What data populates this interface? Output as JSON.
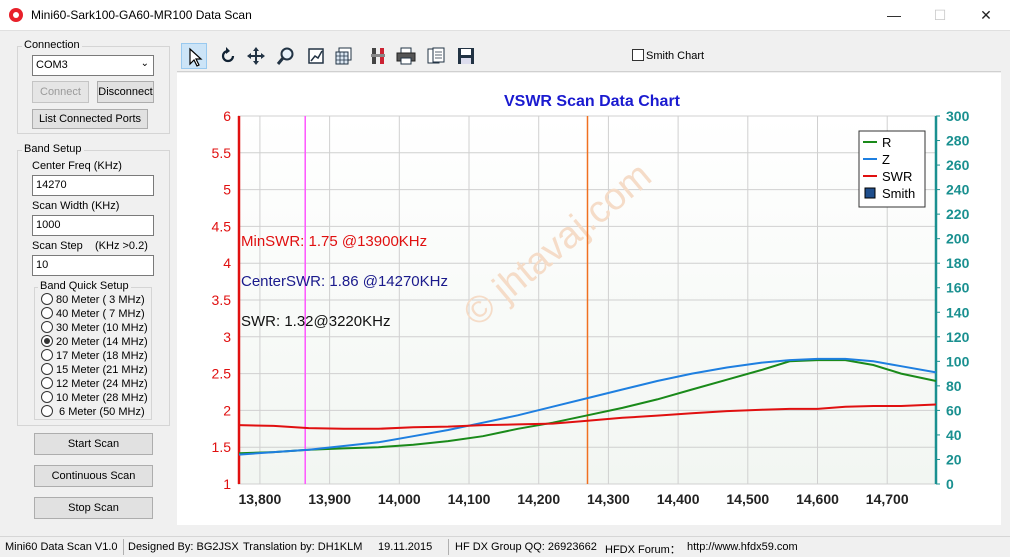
{
  "window": {
    "title": "Mini60-Sark100-GA60-MR100 Data Scan",
    "minimize": "—",
    "maximize": "☐",
    "close": "✕"
  },
  "connection": {
    "group_title": "Connection",
    "port": "COM3",
    "connect_label": "Connect",
    "disconnect_label": "Disconnect",
    "list_ports_label": "List Connected Ports"
  },
  "band_setup": {
    "group_title": "Band Setup",
    "center_freq_label": "Center Freq  (KHz)",
    "center_freq_value": "14270",
    "scan_width_label": "Scan Width   (KHz)",
    "scan_width_value": "1000",
    "scan_step_label": "Scan Step",
    "scan_step_hint": "(KHz >0.2)",
    "scan_step_value": "10",
    "quick_title": "Band Quick Setup",
    "bands": [
      {
        "label": "80 Meter (  3 MHz)",
        "checked": false
      },
      {
        "label": "40 Meter (  7 MHz)",
        "checked": false
      },
      {
        "label": "30 Meter (10 MHz)",
        "checked": false
      },
      {
        "label": "20 Meter (14 MHz)",
        "checked": true
      },
      {
        "label": "17 Meter (18 MHz)",
        "checked": false
      },
      {
        "label": "15 Meter (21 MHz)",
        "checked": false
      },
      {
        "label": "12 Meter (24 MHz)",
        "checked": false
      },
      {
        "label": "10 Meter (28 MHz)",
        "checked": false
      },
      {
        "label": "  6 Meter  (50 MHz)",
        "checked": false
      }
    ]
  },
  "actions": {
    "start": "Start Scan",
    "continuous": "Continuous Scan",
    "stop": "Stop Scan"
  },
  "toolbar": {
    "smith_chart_label": "Smith Chart",
    "smith_chart_checked": false
  },
  "watermark": "© jhtavaj.com",
  "chart_data": {
    "type": "line",
    "title": "VSWR Scan Data Chart",
    "x_ticks": [
      "13,800",
      "13,900",
      "14,000",
      "14,100",
      "14,200",
      "14,300",
      "14,400",
      "14,500",
      "14,600",
      "14,700"
    ],
    "x_tick_values": [
      13800,
      13900,
      14000,
      14100,
      14200,
      14300,
      14400,
      14500,
      14600,
      14700
    ],
    "xlim": [
      13770,
      14770
    ],
    "y_left_ticks": [
      "1",
      "1.5",
      "2",
      "2.5",
      "3",
      "3.5",
      "4",
      "4.5",
      "5",
      "5.5",
      "6"
    ],
    "y_left_lim": [
      1,
      6
    ],
    "y_right_ticks": [
      "0",
      "20",
      "40",
      "60",
      "80",
      "100",
      "120",
      "140",
      "160",
      "180",
      "200",
      "220",
      "240",
      "260",
      "280",
      "300"
    ],
    "y_right_lim": [
      0,
      300
    ],
    "grid": true,
    "legend_position": "top-right",
    "legend": [
      {
        "name": "R",
        "color": "#1a8a1a",
        "kind": "line"
      },
      {
        "name": "Z",
        "color": "#1e7fe0",
        "kind": "line"
      },
      {
        "name": "SWR",
        "color": "#e01010",
        "kind": "line"
      },
      {
        "name": "Smith",
        "color": "#1f4e8c",
        "kind": "box"
      }
    ],
    "annotations": [
      {
        "text": "MinSWR: 1.75 @13900KHz",
        "color": "#e01010"
      },
      {
        "text": "CenterSWR: 1.86 @14270KHz",
        "color": "#1a1a8c"
      },
      {
        "text": "SWR: 1.32@3220KHz",
        "color": "#111111"
      }
    ],
    "markers": [
      {
        "x": 13865,
        "color": "#ff55ff"
      },
      {
        "x": 14270,
        "color": "#f07020"
      }
    ],
    "x": [
      13770,
      13820,
      13870,
      13920,
      13970,
      14020,
      14070,
      14120,
      14170,
      14220,
      14270,
      14320,
      14370,
      14420,
      14470,
      14520,
      14560,
      14600,
      14640,
      14680,
      14720,
      14770
    ],
    "series": [
      {
        "name": "R",
        "axis": "right",
        "color": "#1a8a1a",
        "values": [
          25,
          26,
          28,
          29,
          30,
          32,
          35,
          39,
          45,
          50,
          56,
          62,
          69,
          77,
          85,
          93,
          100,
          101,
          101,
          97,
          90,
          84
        ]
      },
      {
        "name": "Z",
        "axis": "right",
        "color": "#1e7fe0",
        "values": [
          24,
          26,
          28,
          31,
          34,
          39,
          44,
          50,
          56,
          63,
          70,
          77,
          84,
          90,
          95,
          99,
          101,
          102,
          102,
          100,
          96,
          91
        ]
      },
      {
        "name": "SWR",
        "axis": "left",
        "color": "#e01010",
        "values": [
          1.8,
          1.79,
          1.76,
          1.75,
          1.75,
          1.77,
          1.78,
          1.8,
          1.81,
          1.82,
          1.86,
          1.9,
          1.93,
          1.96,
          1.99,
          2.01,
          2.02,
          2.02,
          2.05,
          2.06,
          2.06,
          2.08
        ]
      }
    ]
  },
  "status": {
    "version": "Mini60 Data Scan V1.0",
    "designed": "Designed By: BG2JSX",
    "translation": "Translation by: DH1KLM",
    "date": "19.11.2015",
    "group": "HF DX Group QQ: 26923662",
    "forum": "HFDX Forum：",
    "url": "http://www.hfdx59.com"
  }
}
